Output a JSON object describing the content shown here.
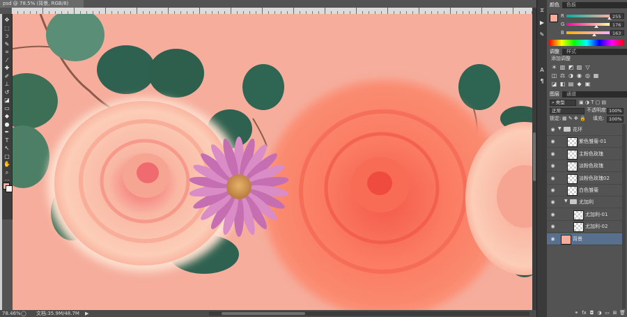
{
  "document": {
    "tab_title": "psd @ 78.5% (背景, RGB/8)"
  },
  "status": {
    "zoom": "78.46%",
    "doc_size": "文档:35.9M/48.7M"
  },
  "tools": [
    {
      "icon": "move-icon",
      "glyph": "✥"
    },
    {
      "icon": "marquee-icon",
      "glyph": "⬚"
    },
    {
      "icon": "lasso-icon",
      "glyph": "ↄ"
    },
    {
      "icon": "quick-select-icon",
      "glyph": "✎"
    },
    {
      "icon": "crop-icon",
      "glyph": "⌗"
    },
    {
      "icon": "eyedropper-icon",
      "glyph": "⁄"
    },
    {
      "icon": "healing-icon",
      "glyph": "✚"
    },
    {
      "icon": "brush-icon",
      "glyph": "✐"
    },
    {
      "icon": "stamp-icon",
      "glyph": "⊥"
    },
    {
      "icon": "history-brush-icon",
      "glyph": "↺"
    },
    {
      "icon": "eraser-icon",
      "glyph": "◪"
    },
    {
      "icon": "gradient-icon",
      "glyph": "▭"
    },
    {
      "icon": "blur-icon",
      "glyph": "◆"
    },
    {
      "icon": "dodge-icon",
      "glyph": "●"
    },
    {
      "icon": "pen-icon",
      "glyph": "✒"
    },
    {
      "icon": "type-icon",
      "glyph": "T"
    },
    {
      "icon": "path-select-icon",
      "glyph": "↖"
    },
    {
      "icon": "shape-icon",
      "glyph": "▢"
    },
    {
      "icon": "hand-icon",
      "glyph": "✋"
    },
    {
      "icon": "zoom-icon",
      "glyph": "⌕"
    },
    {
      "icon": "more-icon",
      "glyph": "⋯"
    }
  ],
  "colors": {
    "foreground": "#f6ad9c",
    "background": "#ffffff",
    "canvas_bg": "#f6ad9c",
    "selection": "#596f8e"
  },
  "color_panel": {
    "tabs": [
      "颜色",
      "色板"
    ],
    "active_tab": 0,
    "channels": [
      {
        "label": "R",
        "value": "255",
        "level": 1.0
      },
      {
        "label": "G",
        "value": "176",
        "level": 0.69
      },
      {
        "label": "B",
        "value": "163",
        "level": 0.64
      }
    ]
  },
  "adjust_panel": {
    "tabs": [
      "调整",
      "样式"
    ],
    "active_tab": 0,
    "title": "添加调整",
    "row1": [
      "☀",
      "▥",
      "◩",
      "▨",
      "▽"
    ],
    "row2": [
      "◫",
      "⚖",
      "◑",
      "◉",
      "◎",
      "▦"
    ],
    "row3": [
      "◪",
      "◧",
      "▤",
      "◆",
      "▣"
    ]
  },
  "layers_panel": {
    "tabs": [
      "图层",
      "通道"
    ],
    "active_tab": 0,
    "filter": "类型",
    "blend_mode": "正常",
    "opacity_label": "不透明度:",
    "opacity": "100%",
    "lock_label": "锁定:",
    "fill_label": "填充:",
    "fill": "100%",
    "layers": [
      {
        "name": "花环",
        "kind": "group",
        "indent": 0
      },
      {
        "name": "紫色雏菊-01",
        "kind": "layer",
        "indent": 1
      },
      {
        "name": "主粉色玫瑰",
        "kind": "layer",
        "indent": 1
      },
      {
        "name": "淡粉色玫瑰",
        "kind": "layer",
        "indent": 1
      },
      {
        "name": "淡粉色玫瑰02",
        "kind": "layer",
        "indent": 1
      },
      {
        "name": "白色雏菊",
        "kind": "layer",
        "indent": 1
      },
      {
        "name": "尤加利",
        "kind": "group",
        "indent": 1
      },
      {
        "name": "尤加利-01",
        "kind": "layer",
        "indent": 2
      },
      {
        "name": "尤加利-02",
        "kind": "layer",
        "indent": 2
      },
      {
        "name": "背景",
        "kind": "background",
        "indent": 0,
        "selected": true
      }
    ],
    "footer_icons": [
      "link-icon",
      "fx-icon",
      "mask-icon",
      "adjustment-icon",
      "folder-icon",
      "new-layer-icon",
      "trash-icon"
    ]
  },
  "side_icons": [
    "history-icon",
    "play-icon",
    "brush-preset-icon",
    "character-icon",
    "paragraph-icon"
  ]
}
